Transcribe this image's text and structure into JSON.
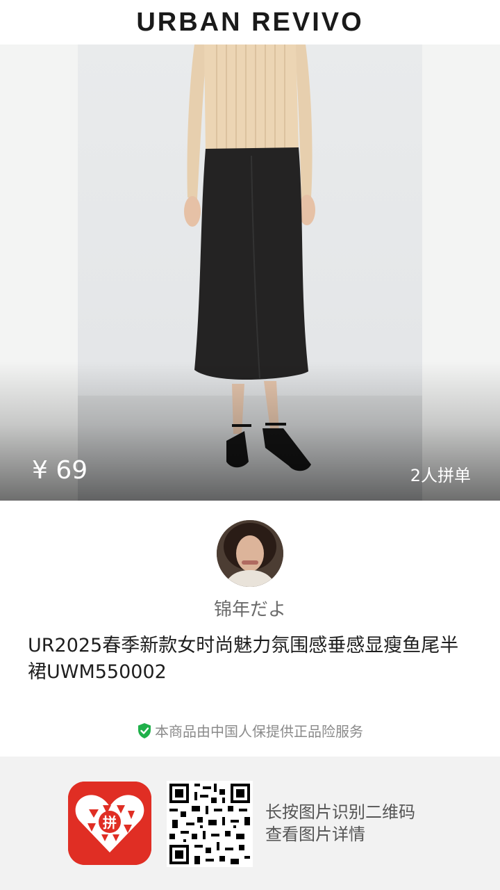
{
  "brand": {
    "name": "URBAN REVIVO"
  },
  "product": {
    "price": "¥ 69",
    "group_buy": "2人拼单",
    "title": "UR2025春季新款女时尚魅力氛围感垂感显瘦鱼尾半裙UWM550002",
    "guarantee": "本商品由中国人保提供正品险服务"
  },
  "seller": {
    "username": "锦年だよ"
  },
  "footer": {
    "scan_line1": "长按图片识别二维码",
    "scan_line2": "查看图片详情",
    "app_logo_text": "拼"
  },
  "colors": {
    "guarantee_icon": "#1fb04a",
    "app_logo_bg": "#e02e24"
  },
  "icons": {
    "guarantee": "shield-check-icon",
    "app_logo": "pinduoduo-logo-icon",
    "qr": "qr-code-icon"
  }
}
